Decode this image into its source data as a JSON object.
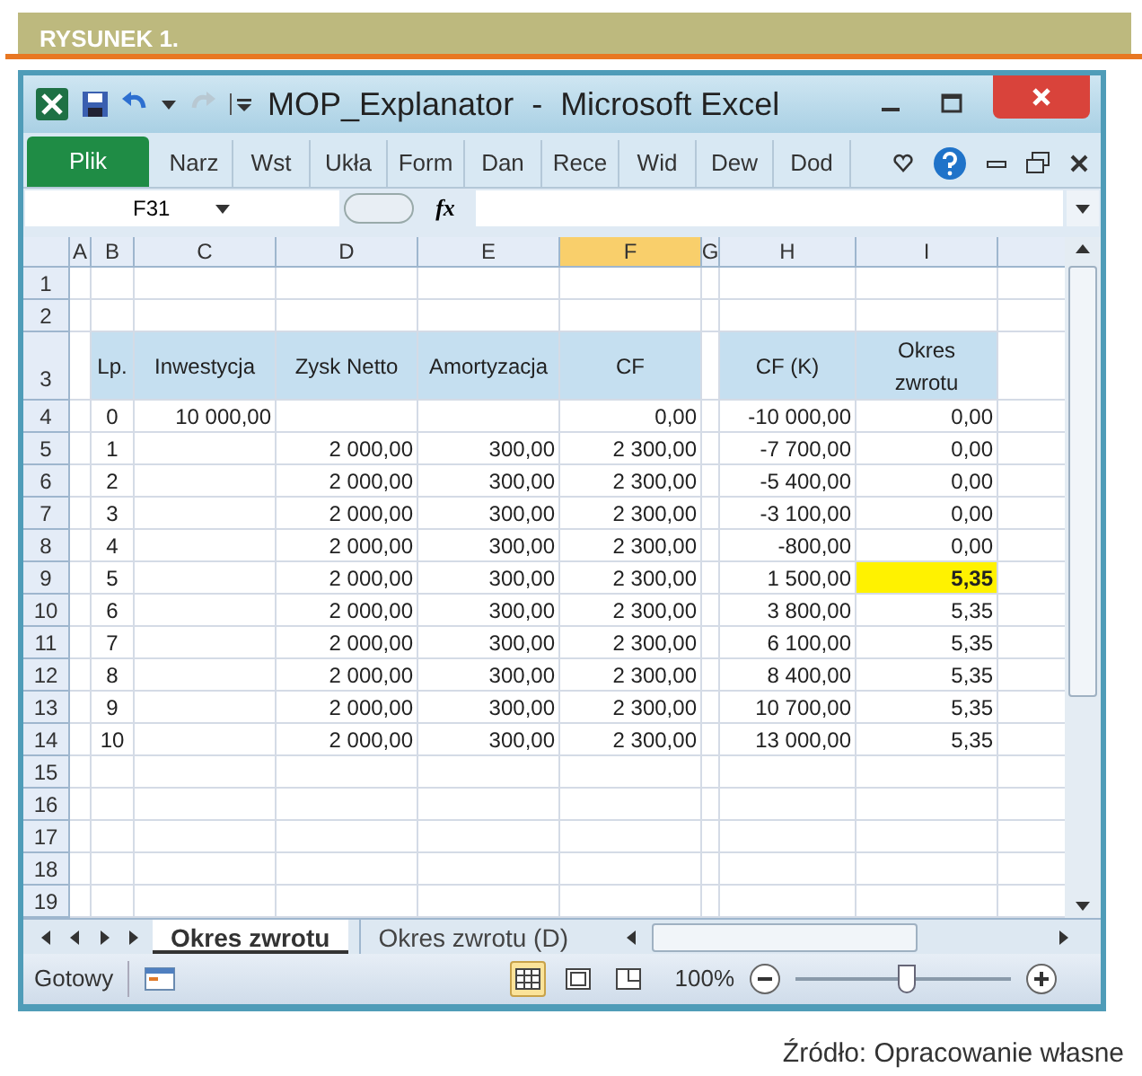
{
  "figure_label": "RYSUNEK 1.",
  "window": {
    "title": "MOP_Explanator  -  Microsoft Excel"
  },
  "ribbon_tabs": [
    {
      "label": "Plik",
      "kind": "file"
    },
    {
      "label": "Narz",
      "kind": "tab"
    },
    {
      "label": "Wst",
      "kind": "tab"
    },
    {
      "label": "Ukła",
      "kind": "tab"
    },
    {
      "label": "Form",
      "kind": "tab"
    },
    {
      "label": "Dan",
      "kind": "tab"
    },
    {
      "label": "Rece",
      "kind": "tab"
    },
    {
      "label": "Wid",
      "kind": "tab"
    },
    {
      "label": "Dew",
      "kind": "tab"
    },
    {
      "label": "Dod",
      "kind": "tab"
    }
  ],
  "formula_bar": {
    "name_box": "F31",
    "function_label": "fx"
  },
  "grid": {
    "columns": [
      {
        "label": "A",
        "selected": false
      },
      {
        "label": "B",
        "selected": false
      },
      {
        "label": "C",
        "selected": false
      },
      {
        "label": "D",
        "selected": false
      },
      {
        "label": "E",
        "selected": false
      },
      {
        "label": "F",
        "selected": true
      },
      {
        "label": "G",
        "selected": false
      },
      {
        "label": "H",
        "selected": false
      },
      {
        "label": "I",
        "selected": false
      }
    ],
    "rows": [
      {
        "number": "1"
      },
      {
        "number": "2"
      },
      {
        "number": "3",
        "kind": "header",
        "cells": {
          "b": "Lp.",
          "c": "Inwestycja",
          "d": "Zysk Netto",
          "e": "Amortyzacja",
          "f": "CF",
          "h": "CF (K)",
          "i": "Okres zwrotu"
        }
      },
      {
        "number": "4",
        "kind": "data",
        "highlight": false,
        "cells": {
          "b": "0",
          "c": "10 000,00",
          "f": "0,00",
          "h": "-10 000,00",
          "i": "0,00"
        }
      },
      {
        "number": "5",
        "kind": "data",
        "highlight": false,
        "cells": {
          "b": "1",
          "d": "2 000,00",
          "e": "300,00",
          "f": "2 300,00",
          "h": "-7 700,00",
          "i": "0,00"
        }
      },
      {
        "number": "6",
        "kind": "data",
        "highlight": false,
        "cells": {
          "b": "2",
          "d": "2 000,00",
          "e": "300,00",
          "f": "2 300,00",
          "h": "-5 400,00",
          "i": "0,00"
        }
      },
      {
        "number": "7",
        "kind": "data",
        "highlight": false,
        "cells": {
          "b": "3",
          "d": "2 000,00",
          "e": "300,00",
          "f": "2 300,00",
          "h": "-3 100,00",
          "i": "0,00"
        }
      },
      {
        "number": "8",
        "kind": "data",
        "highlight": false,
        "cells": {
          "b": "4",
          "d": "2 000,00",
          "e": "300,00",
          "f": "2 300,00",
          "h": "-800,00",
          "i": "0,00"
        }
      },
      {
        "number": "9",
        "kind": "data",
        "highlight": true,
        "cells": {
          "b": "5",
          "d": "2 000,00",
          "e": "300,00",
          "f": "2 300,00",
          "h": "1 500,00",
          "i": "5,35"
        }
      },
      {
        "number": "10",
        "kind": "data",
        "highlight": false,
        "cells": {
          "b": "6",
          "d": "2 000,00",
          "e": "300,00",
          "f": "2 300,00",
          "h": "3 800,00",
          "i": "5,35"
        }
      },
      {
        "number": "11",
        "kind": "data",
        "highlight": false,
        "cells": {
          "b": "7",
          "d": "2 000,00",
          "e": "300,00",
          "f": "2 300,00",
          "h": "6 100,00",
          "i": "5,35"
        }
      },
      {
        "number": "12",
        "kind": "data",
        "highlight": false,
        "cells": {
          "b": "8",
          "d": "2 000,00",
          "e": "300,00",
          "f": "2 300,00",
          "h": "8 400,00",
          "i": "5,35"
        }
      },
      {
        "number": "13",
        "kind": "data",
        "highlight": false,
        "cells": {
          "b": "9",
          "d": "2 000,00",
          "e": "300,00",
          "f": "2 300,00",
          "h": "10 700,00",
          "i": "5,35"
        }
      },
      {
        "number": "14",
        "kind": "data",
        "highlight": false,
        "cells": {
          "b": "10",
          "d": "2 000,00",
          "e": "300,00",
          "f": "2 300,00",
          "h": "13 000,00",
          "i": "5,35"
        }
      },
      {
        "number": "15"
      },
      {
        "number": "16"
      },
      {
        "number": "17"
      },
      {
        "number": "18"
      },
      {
        "number": "19"
      }
    ]
  },
  "sheet_tabs": [
    {
      "label": "Okres zwrotu",
      "selected": true
    },
    {
      "label": "Okres zwrotu (D)",
      "selected": false
    }
  ],
  "status_bar": {
    "status": "Gotowy",
    "views": [
      {
        "selected": true
      },
      {
        "selected": false
      },
      {
        "selected": false
      }
    ],
    "zoom": "100%",
    "zoom_level": {
      "level": 0.52
    }
  },
  "caption": "Źródło: Opracowanie własne"
}
